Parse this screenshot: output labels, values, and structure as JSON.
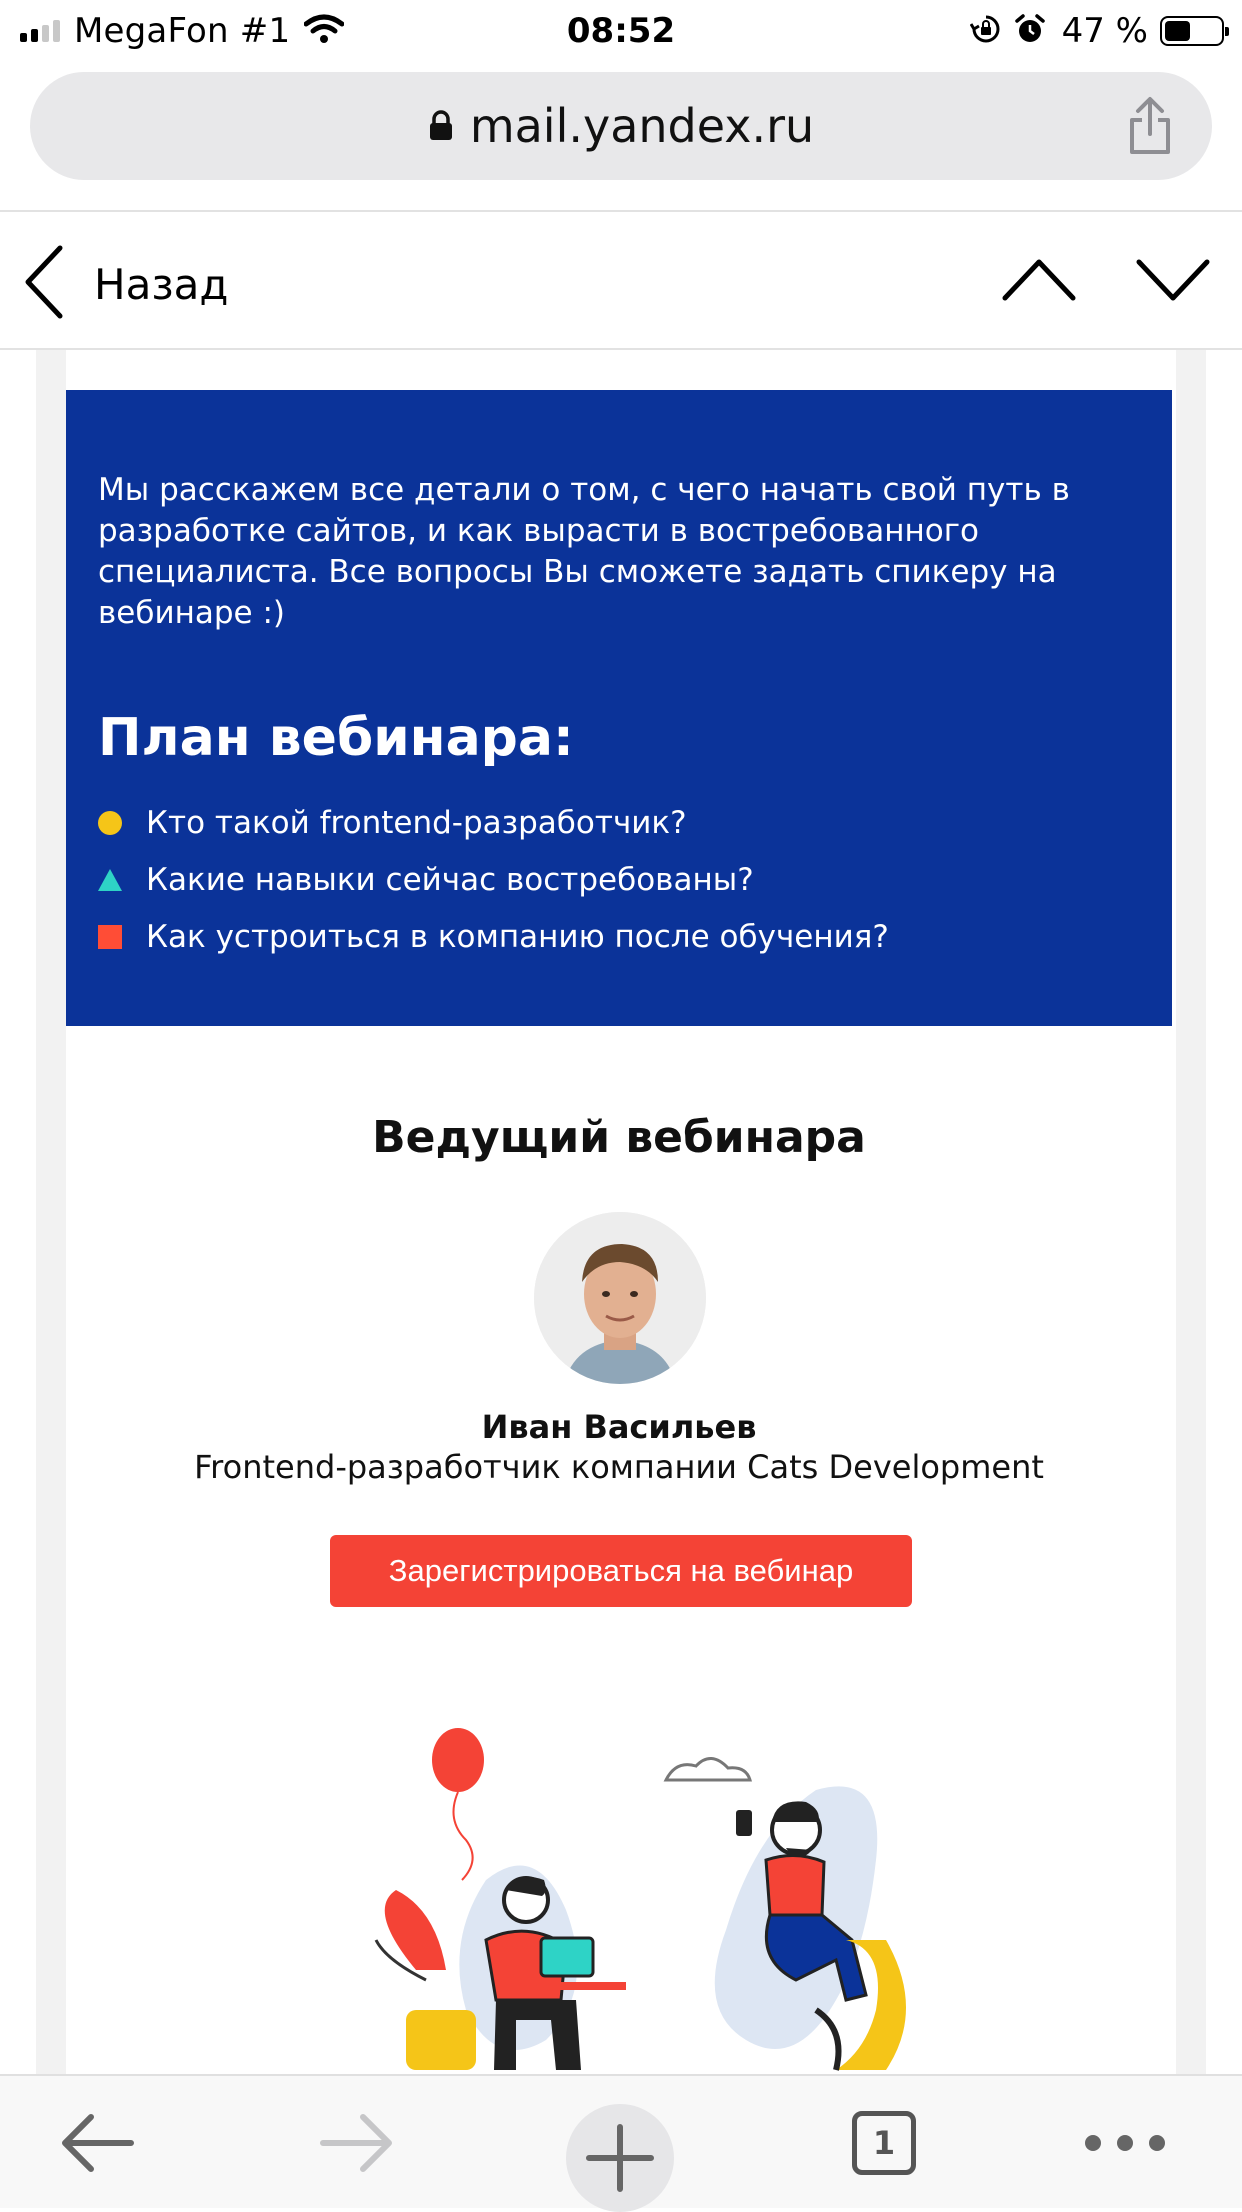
{
  "status_bar": {
    "carrier": "MegaFon #1",
    "time": "08:52",
    "battery_percent": "47 %",
    "battery_level": 0.47,
    "signal_bars": 2,
    "icons": [
      "signal-icon",
      "wifi-icon",
      "orientation-lock-icon",
      "alarm-icon",
      "battery-icon"
    ]
  },
  "url_bar": {
    "url": "mail.yandex.ru",
    "icons": [
      "lock-icon",
      "share-icon"
    ]
  },
  "nav_header": {
    "back_label": "Назад",
    "icons": [
      "back-chevron-icon",
      "previous-message-icon",
      "next-message-icon"
    ]
  },
  "email": {
    "intro_text": "Мы расскажем все детали о том, с чего начать свой путь в разработке сайтов, и как вырасти в востребованного специалиста. Все вопросы Вы сможете задать спикеру на вебинаре :)",
    "plan_title": "План вебинара:",
    "plan_items": [
      {
        "text": "Кто такой frontend-разработчик?",
        "bullet": "circle",
        "color": "#f5c518"
      },
      {
        "text": "Какие навыки сейчас востребованы?",
        "bullet": "triangle",
        "color": "#2ed3c6"
      },
      {
        "text": "Как устроиться в компанию после обучения?",
        "bullet": "square",
        "color": "#ff4d36"
      }
    ],
    "host_title": "Ведущий вебинара",
    "host_name": "Иван Васильев",
    "host_role": "Frontend-разработчик компании Cats Development",
    "register_button": "Зарегистрироваться на вебинар",
    "colors": {
      "banner_bg": "#0b3399",
      "button_bg": "#f44336"
    }
  },
  "toolbar": {
    "tabs_count": "1",
    "icons": [
      "back-arrow-icon",
      "forward-arrow-icon",
      "new-tab-plus-icon",
      "tabs-icon",
      "more-icon"
    ]
  }
}
